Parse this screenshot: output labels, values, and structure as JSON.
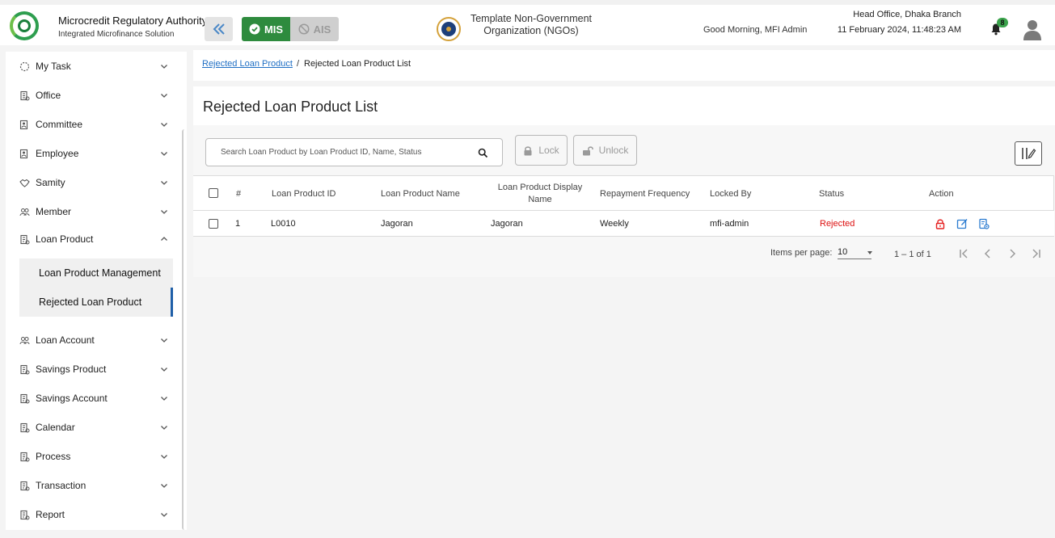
{
  "header": {
    "logo_text": "Microcredit Regulatory Authority",
    "brand_title": "Microcredit Regulatory Authority",
    "brand_subtitle": "Integrated Microfinance Solution",
    "mis_label": "MIS",
    "ais_label": "AIS",
    "org_line1": "Template Non-Government",
    "org_line2": "Organization (NGOs)",
    "greeting": "Good Morning, MFI Admin",
    "branch": "Head Office, Dhaka Branch",
    "datetime": "11 February 2024, 11:48:23 AM",
    "notification_count": "8"
  },
  "sidebar": {
    "items": [
      {
        "label": "My Task",
        "icon": "circle-dashed-icon"
      },
      {
        "label": "Office",
        "icon": "building-icon"
      },
      {
        "label": "Committee",
        "icon": "group-icon"
      },
      {
        "label": "Employee",
        "icon": "id-card-icon"
      },
      {
        "label": "Samity",
        "icon": "handshake-icon"
      },
      {
        "label": "Member",
        "icon": "users-icon"
      },
      {
        "label": "Loan Product",
        "icon": "document-icon"
      },
      {
        "label": "Loan Account",
        "icon": "users-icon"
      },
      {
        "label": "Savings Product",
        "icon": "document-icon"
      },
      {
        "label": "Savings Account",
        "icon": "document-icon"
      },
      {
        "label": "Calendar",
        "icon": "document-icon"
      },
      {
        "label": "Process",
        "icon": "document-icon"
      },
      {
        "label": "Transaction",
        "icon": "document-icon"
      },
      {
        "label": "Report",
        "icon": "document-icon"
      }
    ],
    "sub_items": [
      {
        "label": "Loan Product Management"
      },
      {
        "label": "Rejected Loan Product"
      }
    ]
  },
  "breadcrumb": {
    "link": "Rejected Loan Product",
    "separator": "/",
    "current": "Rejected Loan Product List"
  },
  "page": {
    "title": "Rejected Loan Product List",
    "search_placeholder": "Search Loan Product by Loan Product ID, Name, Status",
    "lock_label": "Lock",
    "unlock_label": "Unlock"
  },
  "table": {
    "headers": {
      "num": "#",
      "id": "Loan Product ID",
      "name": "Loan Product Name",
      "display_line1": "Loan Product Display",
      "display_line2": "Name",
      "freq": "Repayment Frequency",
      "locked_by": "Locked By",
      "status": "Status",
      "action": "Action"
    },
    "rows": [
      {
        "num": "1",
        "id": "L0010",
        "name": "Jagoran",
        "display": "Jagoran",
        "freq": "Weekly",
        "locked_by": "mfi-admin",
        "status": "Rejected"
      }
    ]
  },
  "pagination": {
    "items_per_page_label": "Items per page:",
    "items_per_page": "10",
    "range": "1 – 1 of 1"
  },
  "colors": {
    "accent_green": "#2e8b3e",
    "link_blue": "#1f6fc4",
    "rejected_red": "#d11111",
    "active_bar": "#1f5fa8"
  }
}
